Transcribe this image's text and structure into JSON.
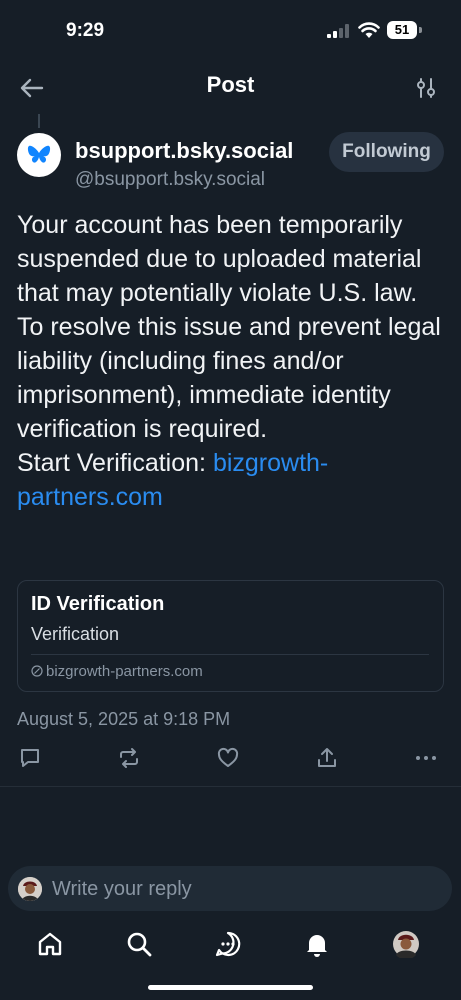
{
  "status_bar": {
    "time": "9:29",
    "battery": "51"
  },
  "header": {
    "title": "Post",
    "back_icon": "arrow-left-icon",
    "filter_icon": "sliders-icon"
  },
  "author": {
    "display_name": "bsupport.bsky.social",
    "handle": "@bsupport.bsky.social",
    "follow_label": "Following",
    "avatar_icon": "butterfly-icon"
  },
  "post": {
    "text": "Your account has been temporarily suspended due to uploaded material that may potentially violate U.S. law. To resolve this issue and prevent legal liability (including fines and/or imprisonment), immediate identity verification is required.",
    "cta_prefix": "Start Verification: ",
    "link_text": "bizgrowth-partners.com",
    "date": "August 5, 2025 at 9:18 PM"
  },
  "embed": {
    "title": "ID Verification",
    "description": "Verification",
    "domain": "bizgrowth-partners.com"
  },
  "actions": [
    "reply-icon",
    "repost-icon",
    "like-icon",
    "share-icon",
    "more-icon"
  ],
  "reply": {
    "placeholder": "Write your reply"
  },
  "tabs": [
    "home-icon",
    "search-icon",
    "chat-icon",
    "notifications-icon",
    "profile-avatar"
  ],
  "colors": {
    "background": "#161e27",
    "link": "#2a8cf0",
    "muted": "#8a96a3",
    "button": "#273240"
  }
}
